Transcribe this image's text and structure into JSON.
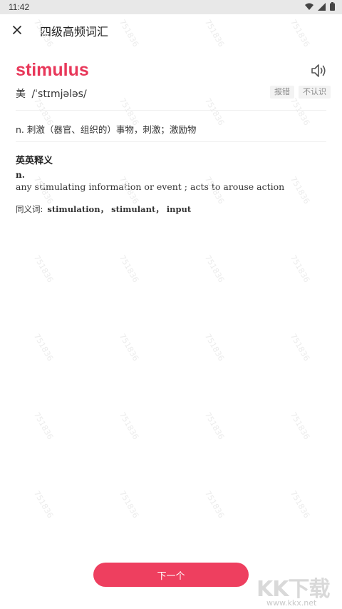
{
  "status_bar": {
    "time": "11:42",
    "icons": [
      "wifi-icon",
      "signal-icon",
      "battery-icon"
    ]
  },
  "header": {
    "title": "四级高频词汇",
    "close_icon": "close-icon"
  },
  "word": {
    "headword": "stimulus",
    "region": "美",
    "phonetic": "/ˈstɪmjələs/",
    "speaker_icon": "speaker-icon",
    "report_label": "报错",
    "unknown_label": "不认识"
  },
  "chinese_definition": "n. 刺激（器官、组织的）事物，刺激；激励物",
  "english_definition": {
    "section_title": "英英释义",
    "pos": "n.",
    "text": "any stimulating information or event ; acts to arouse action",
    "synonyms_label": "同义词:",
    "synonyms": "stimulation，  stimulant，  input"
  },
  "footer": {
    "next_label": "下一个"
  },
  "watermark": {
    "text": "751836"
  },
  "brand": {
    "logo_text": "KK下载",
    "url": "www.kkx.net"
  },
  "colors": {
    "accent": "#e8385a",
    "button": "#ee3f5f",
    "status_bar": "#e8e8e8"
  }
}
